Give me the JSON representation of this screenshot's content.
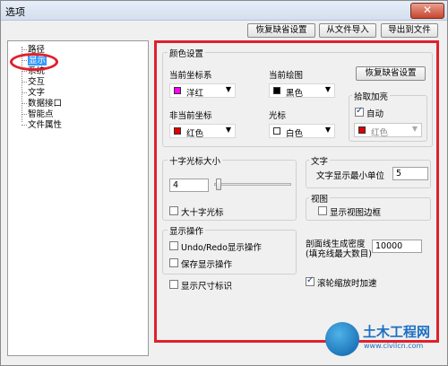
{
  "window": {
    "title": "选项",
    "close_label": "✕"
  },
  "top_buttons": {
    "restore_defaults": "恢复缺省设置",
    "import_from_file": "从文件导入",
    "export_to_file": "导出到文件"
  },
  "tree": {
    "items": [
      {
        "label": "路径"
      },
      {
        "label": "显示",
        "selected": true
      },
      {
        "label": "系统"
      },
      {
        "label": "交互"
      },
      {
        "label": "文字"
      },
      {
        "label": "数据接口"
      },
      {
        "label": "智能点"
      },
      {
        "label": "文件属性"
      }
    ]
  },
  "colors": {
    "group_title": "颜色设置",
    "current_coord_label": "当前坐标系",
    "current_coord_value": "洋红",
    "current_coord_color": "#ff00ff",
    "current_drawing_label": "当前绘图",
    "current_drawing_value": "黑色",
    "current_drawing_color": "#000000",
    "restore_btn": "恢复缺省设置",
    "noncurrent_coord_label": "非当前坐标",
    "noncurrent_coord_value": "红色",
    "noncurrent_coord_color": "#e00000",
    "cursor_label": "光标",
    "cursor_value": "白色",
    "cursor_color": "#ffffff",
    "pick_highlight_title": "拾取加亮",
    "auto_label": "自动",
    "auto_checked": true,
    "pick_color_value": "红色",
    "pick_color": "#e00000"
  },
  "crosshair": {
    "title": "十字光标大小",
    "size_value": "4",
    "large_label": "大十字光标",
    "large_checked": false
  },
  "text": {
    "title": "文字",
    "min_unit_label": "文字显示最小单位",
    "min_unit_value": "5"
  },
  "view": {
    "title": "视图",
    "show_border_label": "显示视图边框",
    "show_border_checked": false
  },
  "display_ops": {
    "title": "显示操作",
    "undo_label": "Undo/Redo显示操作",
    "undo_checked": false,
    "save_label": "保存显示操作",
    "save_checked": false
  },
  "hatch": {
    "label_line1": "剖面线生成密度",
    "label_line2": "(填充线最大数目)",
    "value": "10000"
  },
  "show_dims": {
    "label": "显示尺寸标识",
    "checked": false
  },
  "wheel_zoom": {
    "label": "滚轮缩放时加速",
    "checked": true
  },
  "watermark": {
    "brand": "土木工程网",
    "url": "www.civilcn.com"
  }
}
